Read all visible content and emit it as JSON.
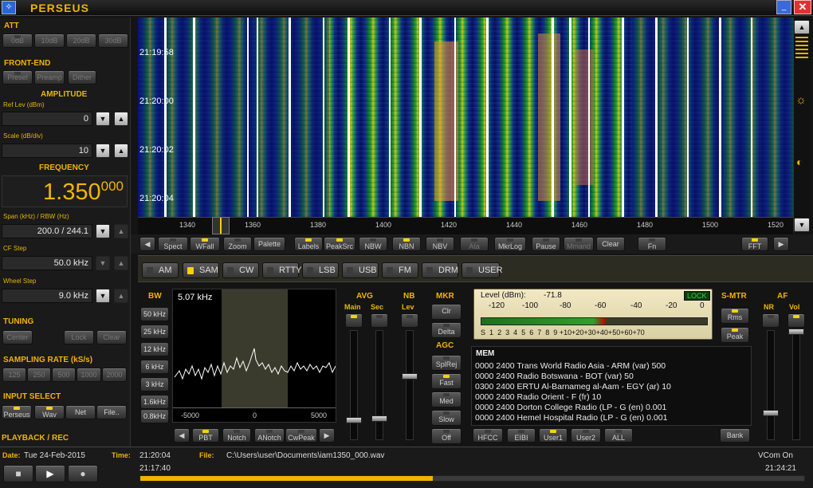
{
  "app": {
    "title": "PERSEUS"
  },
  "colors": {
    "accent": "#f0b400",
    "led_on": "#f7d300",
    "waterfall_bg": "#0a1a6e",
    "lock": "#3bd13b"
  },
  "att": {
    "title": "ATT",
    "buttons": [
      "0dB",
      "10dB",
      "20dB",
      "30dB"
    ]
  },
  "front_end": {
    "title": "FRONT-END",
    "buttons": [
      "Presel",
      "Preamp",
      "Dither"
    ]
  },
  "amplitude": {
    "title": "AMPLITUDE",
    "ref_lev_label": "Ref Lev (dBm)",
    "ref_lev": "0",
    "scale_label": "Scale (dB/div)",
    "scale": "10"
  },
  "frequency": {
    "title": "FREQUENCY",
    "main": "1.350",
    "fraction": "000",
    "span_label": "Span (kHz) / RBW (Hz)",
    "span": "200.0 / 244.1",
    "cf_step_label": "CF Step",
    "cf_step": "50.0 kHz",
    "wheel_step_label": "Wheel Step",
    "wheel_step": "9.0 kHz"
  },
  "tuning": {
    "title": "TUNING",
    "buttons": [
      "Center",
      "Lock",
      "Clear"
    ]
  },
  "sampling": {
    "title": "SAMPLING RATE (kS/s)",
    "buttons": [
      "125",
      "250",
      "500",
      "1000",
      "2000"
    ]
  },
  "input": {
    "title": "INPUT SELECT",
    "buttons": [
      "Perseus",
      "Wav",
      "Net",
      "File.."
    ]
  },
  "playback": {
    "title": "PLAYBACK / REC"
  },
  "waterfall": {
    "timestamps": [
      "21:19:58",
      "21:20:00",
      "21:20:02",
      "21:20:04"
    ],
    "freq_ticks": [
      "1340",
      "1360",
      "1380",
      "1400",
      "1420",
      "1440",
      "1460",
      "1480",
      "1500",
      "1520"
    ]
  },
  "toolbar": {
    "buttons": [
      "Spect",
      "WFall",
      "Zoom",
      "Palette",
      "Labels",
      "PeakSrc",
      "NBW",
      "NBN",
      "NBV",
      "Ata",
      "MkrLog",
      "Pause",
      "Mmand",
      "Clear",
      "Fn",
      "FFT"
    ]
  },
  "modes": {
    "items": [
      "AM",
      "SAM",
      "CW",
      "RTTY",
      "LSB",
      "USB",
      "FM",
      "DRM",
      "USER"
    ],
    "selected": "SAM"
  },
  "bw": {
    "title": "BW",
    "value": "5.07 kHz",
    "buttons": [
      "50 kHz",
      "25 kHz",
      "12 kHz",
      "6 kHz",
      "3 kHz",
      "1.6kHz",
      "0.8kHz"
    ],
    "axis": [
      "-5000",
      "0",
      "5000"
    ]
  },
  "filter": {
    "buttons": [
      "PBT",
      "Notch",
      "ANotch",
      "CwPeak"
    ]
  },
  "avg": {
    "title": "AVG",
    "main": "Main",
    "sec": "Sec"
  },
  "nb": {
    "title": "NB",
    "lev": "Lev"
  },
  "mkr": {
    "title": "MKR",
    "buttons": [
      "Clr",
      "Delta"
    ]
  },
  "agc": {
    "title": "AGC",
    "buttons": [
      "SplRej",
      "Fast",
      "Med",
      "Slow",
      "Off"
    ]
  },
  "smeter": {
    "level_label": "Level (dBm):",
    "level": "-71.8",
    "lock": "LOCK",
    "dbm_scale": [
      "-120",
      "-100",
      "-80",
      "-60",
      "-40",
      "-20",
      "0"
    ],
    "s_scale": [
      "S",
      "1",
      "2",
      "3",
      "4",
      "5",
      "6",
      "7",
      "8",
      "9",
      "+10",
      "+20",
      "+30",
      "+40",
      "+50",
      "+60",
      "+70"
    ],
    "fill_fraction": 0.55,
    "title": "S-MTR",
    "buttons": [
      "Rms",
      "Peak"
    ]
  },
  "af": {
    "title": "AF",
    "nr": "NR",
    "vol": "Vol"
  },
  "mem": {
    "title": "MEM",
    "lines": [
      "0000 2400 Trans World Radio Asia  - ARM (var)  500",
      "0000 2400 Radio Botswana  - BOT (var)  50",
      "0300 2400 ERTU Al-Barnameg al-Aam  - EGY (ar)  10",
      "0000 2400 Radio Orient  - F (fr)  10",
      "0000 2400 Dorton College Radio (LP - G (en)  0.001",
      "0000 2400 Hemel Hospital Radio (LP - G (en)  0.001"
    ],
    "buttons": [
      "HFCC",
      "EIBI",
      "User1",
      "User2",
      "ALL",
      "Bank"
    ]
  },
  "status": {
    "date_label": "Date:",
    "date": "Tue 24-Feb-2015",
    "time_label": "Time:",
    "time": "21:20:04",
    "file_label": "File:",
    "file": "C:\\Users\\user\\Documents\\iam1350_000.wav",
    "vcom": "VCom On",
    "start": "21:17:40",
    "end": "21:24:21",
    "progress_fraction": 0.44
  }
}
